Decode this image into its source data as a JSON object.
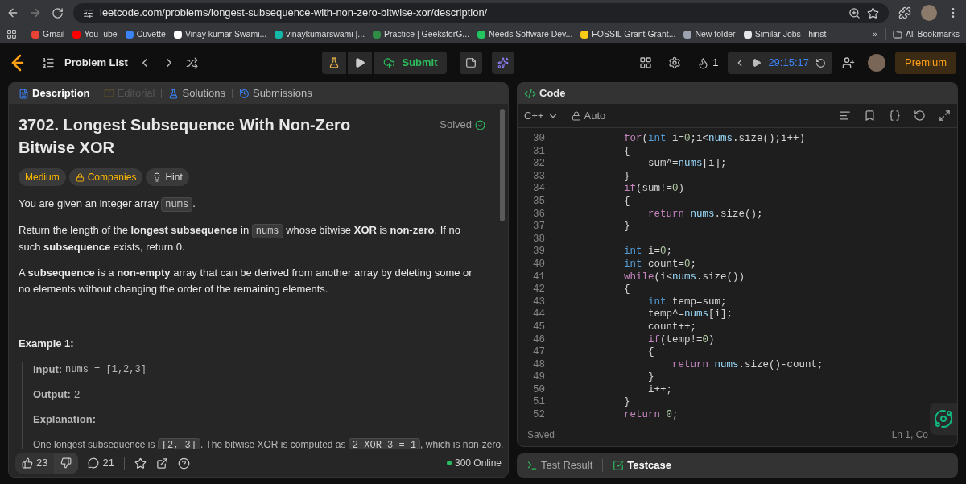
{
  "browser": {
    "url": "leetcode.com/problems/longest-subsequence-with-non-zero-bitwise-xor/description/",
    "bookmarks": [
      {
        "label": "Gmail",
        "color": "#ea4335"
      },
      {
        "label": "YouTube",
        "color": "#ff0000"
      },
      {
        "label": "Cuvette",
        "color": "#3b82f6"
      },
      {
        "label": "Vinay kumar Swami...",
        "color": "#ffffff"
      },
      {
        "label": "vinaykumarswami |...",
        "color": "#14b8a6"
      },
      {
        "label": "Practice | GeeksforG...",
        "color": "#2f8d46"
      },
      {
        "label": "Needs Software Dev...",
        "color": "#22c55e"
      },
      {
        "label": "FOSSIL Grant Grant...",
        "color": "#facc15"
      },
      {
        "label": "New folder",
        "color": "#9ca3af"
      },
      {
        "label": "Similar Jobs - hirist",
        "color": "#e5e7eb"
      }
    ],
    "more": "»",
    "all_bookmarks": "All Bookmarks"
  },
  "nav": {
    "problem_list": "Problem List",
    "submit": "Submit",
    "streak": "1",
    "timer": "29:15:17",
    "premium": "Premium"
  },
  "description": {
    "tabs": [
      {
        "label": "Description",
        "selected": true,
        "disabled": false
      },
      {
        "label": "Editorial",
        "selected": false,
        "disabled": true
      },
      {
        "label": "Solutions",
        "selected": false,
        "disabled": false
      },
      {
        "label": "Submissions",
        "selected": false,
        "disabled": false
      }
    ],
    "title": "3702. Longest Subsequence With Non-Zero Bitwise XOR",
    "status": "Solved",
    "tags": [
      {
        "label": "Medium",
        "kind": "difficulty"
      },
      {
        "label": "Companies",
        "kind": "companies"
      },
      {
        "label": "Hint",
        "kind": "hint"
      }
    ],
    "paragraphs": [
      [
        {
          "kind": "text",
          "text": "You are given an integer array "
        },
        {
          "kind": "code",
          "text": "nums"
        },
        {
          "kind": "text",
          "text": "."
        }
      ],
      [
        {
          "kind": "text",
          "text": "Return the length of the **longest subsequence** in "
        },
        {
          "kind": "code",
          "text": "nums"
        },
        {
          "kind": "text",
          "text": " whose bitwise **XOR** is **non-zero**. If no such **subsequence** exists, return 0."
        }
      ],
      [
        {
          "kind": "text",
          "text": "A **subsequence** is a **non-empty** array that can be derived from another array by deleting some or no elements without changing the order of the remaining elements."
        }
      ]
    ],
    "example": {
      "heading": "Example 1:",
      "input_label": "Input:",
      "input": "nums = [1,2,3]",
      "output_label": "Output:",
      "output": "2",
      "explanation_label": "Explanation:",
      "explanation": [
        {
          "kind": "text",
          "text": "One longest subsequence is "
        },
        {
          "kind": "code",
          "text": "[2, 3]"
        },
        {
          "kind": "text",
          "text": ". The bitwise XOR is computed as "
        },
        {
          "kind": "code",
          "text": "2 XOR 3 = 1"
        },
        {
          "kind": "text",
          "text": ", which is non-zero."
        }
      ]
    },
    "likes": "23",
    "comments": "21",
    "online": "300 Online"
  },
  "code": {
    "title": "Code",
    "language": "C++",
    "mode": "Auto",
    "lines": [
      {
        "n": "30",
        "tokens": [
          {
            "kind": "keyword",
            "t": "        for"
          },
          {
            "kind": "plain",
            "t": "("
          },
          {
            "kind": "type",
            "t": "int"
          },
          {
            "kind": "plain",
            "t": " i="
          },
          {
            "kind": "number",
            "t": "0"
          },
          {
            "kind": "plain",
            "t": ";i<"
          },
          {
            "kind": "member",
            "t": "nums"
          },
          {
            "kind": "plain",
            "t": ".size();i++)"
          }
        ]
      },
      {
        "n": "31",
        "tokens": [
          {
            "kind": "plain",
            "t": "        {"
          }
        ]
      },
      {
        "n": "32",
        "tokens": [
          {
            "kind": "plain",
            "t": "            sum^="
          },
          {
            "kind": "member",
            "t": "nums"
          },
          {
            "kind": "plain",
            "t": "[i];"
          }
        ]
      },
      {
        "n": "33",
        "tokens": [
          {
            "kind": "plain",
            "t": "        }"
          }
        ]
      },
      {
        "n": "34",
        "tokens": [
          {
            "kind": "keyword",
            "t": "        if"
          },
          {
            "kind": "plain",
            "t": "(sum!="
          },
          {
            "kind": "number",
            "t": "0"
          },
          {
            "kind": "plain",
            "t": ")"
          }
        ]
      },
      {
        "n": "35",
        "tokens": [
          {
            "kind": "plain",
            "t": "        {"
          }
        ]
      },
      {
        "n": "36",
        "tokens": [
          {
            "kind": "keyword",
            "t": "            return"
          },
          {
            "kind": "member",
            "t": " nums"
          },
          {
            "kind": "plain",
            "t": ".size();"
          }
        ]
      },
      {
        "n": "37",
        "tokens": [
          {
            "kind": "plain",
            "t": "        }"
          }
        ]
      },
      {
        "n": "38"
      },
      {
        "n": "39",
        "tokens": [
          {
            "kind": "type",
            "t": "        int"
          },
          {
            "kind": "plain",
            "t": " i="
          },
          {
            "kind": "number",
            "t": "0"
          },
          {
            "kind": "plain",
            "t": ";"
          }
        ]
      },
      {
        "n": "40",
        "tokens": [
          {
            "kind": "type",
            "t": "        int"
          },
          {
            "kind": "plain",
            "t": " count="
          },
          {
            "kind": "number",
            "t": "0"
          },
          {
            "kind": "plain",
            "t": ";"
          }
        ]
      },
      {
        "n": "41",
        "tokens": [
          {
            "kind": "keyword",
            "t": "        while"
          },
          {
            "kind": "plain",
            "t": "(i<"
          },
          {
            "kind": "member",
            "t": "nums"
          },
          {
            "kind": "plain",
            "t": ".size())"
          }
        ]
      },
      {
        "n": "42",
        "tokens": [
          {
            "kind": "plain",
            "t": "        {"
          }
        ]
      },
      {
        "n": "43",
        "tokens": [
          {
            "kind": "type",
            "t": "            int"
          },
          {
            "kind": "plain",
            "t": " temp=sum;"
          }
        ]
      },
      {
        "n": "44",
        "tokens": [
          {
            "kind": "plain",
            "t": "            temp^="
          },
          {
            "kind": "member",
            "t": "nums"
          },
          {
            "kind": "plain",
            "t": "[i];"
          }
        ]
      },
      {
        "n": "45",
        "tokens": [
          {
            "kind": "plain",
            "t": "            count++;"
          }
        ]
      },
      {
        "n": "46",
        "tokens": [
          {
            "kind": "keyword",
            "t": "            if"
          },
          {
            "kind": "plain",
            "t": "(temp!="
          },
          {
            "kind": "number",
            "t": "0"
          },
          {
            "kind": "plain",
            "t": ")"
          }
        ]
      },
      {
        "n": "47",
        "tokens": [
          {
            "kind": "plain",
            "t": "            {"
          }
        ]
      },
      {
        "n": "48",
        "tokens": [
          {
            "kind": "keyword",
            "t": "                return"
          },
          {
            "kind": "member",
            "t": " nums"
          },
          {
            "kind": "plain",
            "t": ".size()-count;"
          }
        ]
      },
      {
        "n": "49",
        "tokens": [
          {
            "kind": "plain",
            "t": "            }"
          }
        ]
      },
      {
        "n": "50",
        "tokens": [
          {
            "kind": "plain",
            "t": "            i++;"
          }
        ]
      },
      {
        "n": "51",
        "tokens": [
          {
            "kind": "plain",
            "t": "        }"
          }
        ]
      },
      {
        "n": "52",
        "tokens": [
          {
            "kind": "keyword",
            "t": "        return"
          },
          {
            "kind": "number",
            "t": " 0"
          },
          {
            "kind": "plain",
            "t": ";"
          }
        ]
      }
    ],
    "saved": "Saved",
    "cursor": "Ln 1, Co"
  },
  "bottom_tabs": [
    {
      "label": "Test Result",
      "selected": false
    },
    {
      "label": "Testcase",
      "selected": true
    }
  ]
}
